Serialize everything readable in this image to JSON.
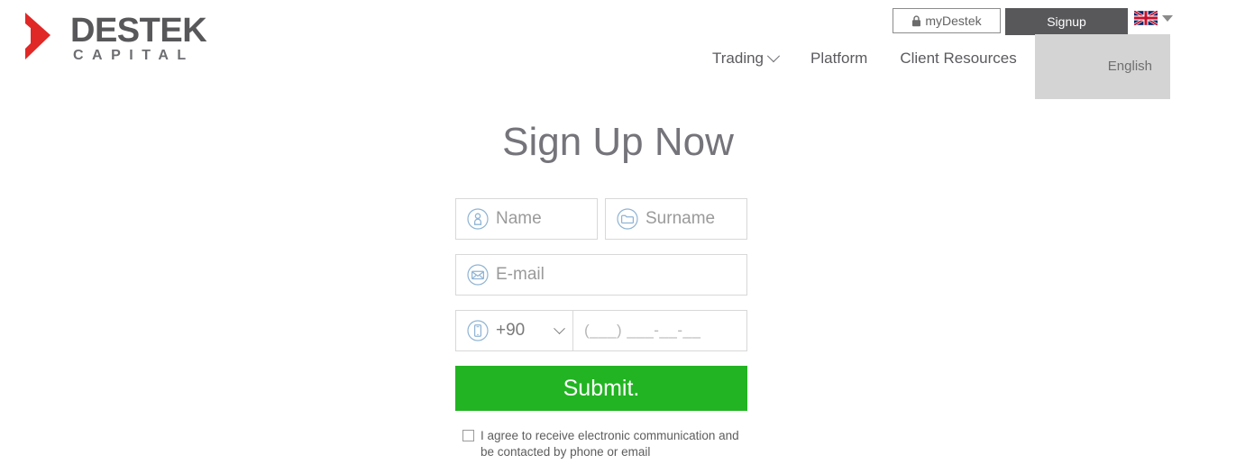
{
  "brand": {
    "name": "DESTEK",
    "tagline": "CAPITAL",
    "mark_color": "#e02826",
    "text_color": "#58585b"
  },
  "header": {
    "buttons": {
      "mydestek_label": "myDestek",
      "mydestek_icon": "lock-icon",
      "signup_label": "Signup"
    },
    "language": {
      "flag_icon": "uk-flag-icon",
      "caret_icon": "caret-down-icon",
      "dropdown_open": true,
      "options": [
        "English"
      ],
      "selected": "English"
    },
    "nav": [
      {
        "label": "Trading",
        "has_dropdown": true,
        "icon": "chevron-down-icon"
      },
      {
        "label": "Platform",
        "has_dropdown": false
      },
      {
        "label": "Client Resources",
        "has_dropdown": false
      }
    ]
  },
  "main": {
    "title": "Sign Up Now",
    "form": {
      "name": {
        "placeholder": "Name",
        "value": "",
        "icon": "user-circle-icon"
      },
      "surname": {
        "placeholder": "Surname",
        "value": "",
        "icon": "folder-circle-icon"
      },
      "email": {
        "placeholder": "E-mail",
        "value": "",
        "icon": "envelope-circle-icon"
      },
      "country_code": {
        "value": "+90",
        "icon": "mobile-circle-icon",
        "caret": "chevron-down-icon"
      },
      "phone": {
        "placeholder": "(___) ___-__-__",
        "value": ""
      },
      "submit_label": "Submit.",
      "submit_color": "#22b422",
      "consent": {
        "checked": false,
        "text": "I agree to receive electronic communication and be contacted by phone or email"
      }
    }
  }
}
